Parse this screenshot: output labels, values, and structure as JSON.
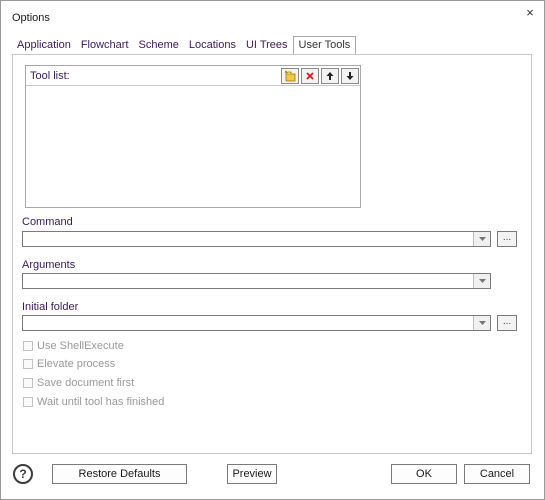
{
  "window": {
    "title": "Options",
    "close_glyph": "×"
  },
  "tabs": [
    {
      "label": "Application"
    },
    {
      "label": "Flowchart"
    },
    {
      "label": "Scheme"
    },
    {
      "label": "Locations"
    },
    {
      "label": "UI Trees"
    },
    {
      "label": "User Tools",
      "active": true
    }
  ],
  "tool_list": {
    "label": "Tool list:",
    "buttons": [
      {
        "icon": "add-icon"
      },
      {
        "icon": "delete-icon"
      },
      {
        "icon": "arrow-up-icon"
      },
      {
        "icon": "arrow-down-icon"
      }
    ],
    "items": []
  },
  "fields": {
    "command": {
      "label": "Command",
      "value": "",
      "browse_label": "..."
    },
    "arguments": {
      "label": "Arguments",
      "value": ""
    },
    "initial_folder": {
      "label": "Initial folder",
      "value": "",
      "browse_label": "..."
    }
  },
  "options": {
    "use_shell_execute": {
      "label": "Use ShellExecute",
      "checked": false
    },
    "elevate_process": {
      "label": "Elevate process",
      "checked": false
    },
    "save_document_first": {
      "label": "Save document first",
      "checked": false
    },
    "wait_until_finished": {
      "label": "Wait until tool has finished",
      "checked": false
    }
  },
  "footer": {
    "help_glyph": "?",
    "restore_defaults": "Restore Defaults",
    "preview": "Preview",
    "ok": "OK",
    "cancel": "Cancel"
  },
  "colors": {
    "delete_red": "#d11a1a",
    "add_yellow": "#e8b400",
    "label_purple": "#3a1a5a"
  }
}
